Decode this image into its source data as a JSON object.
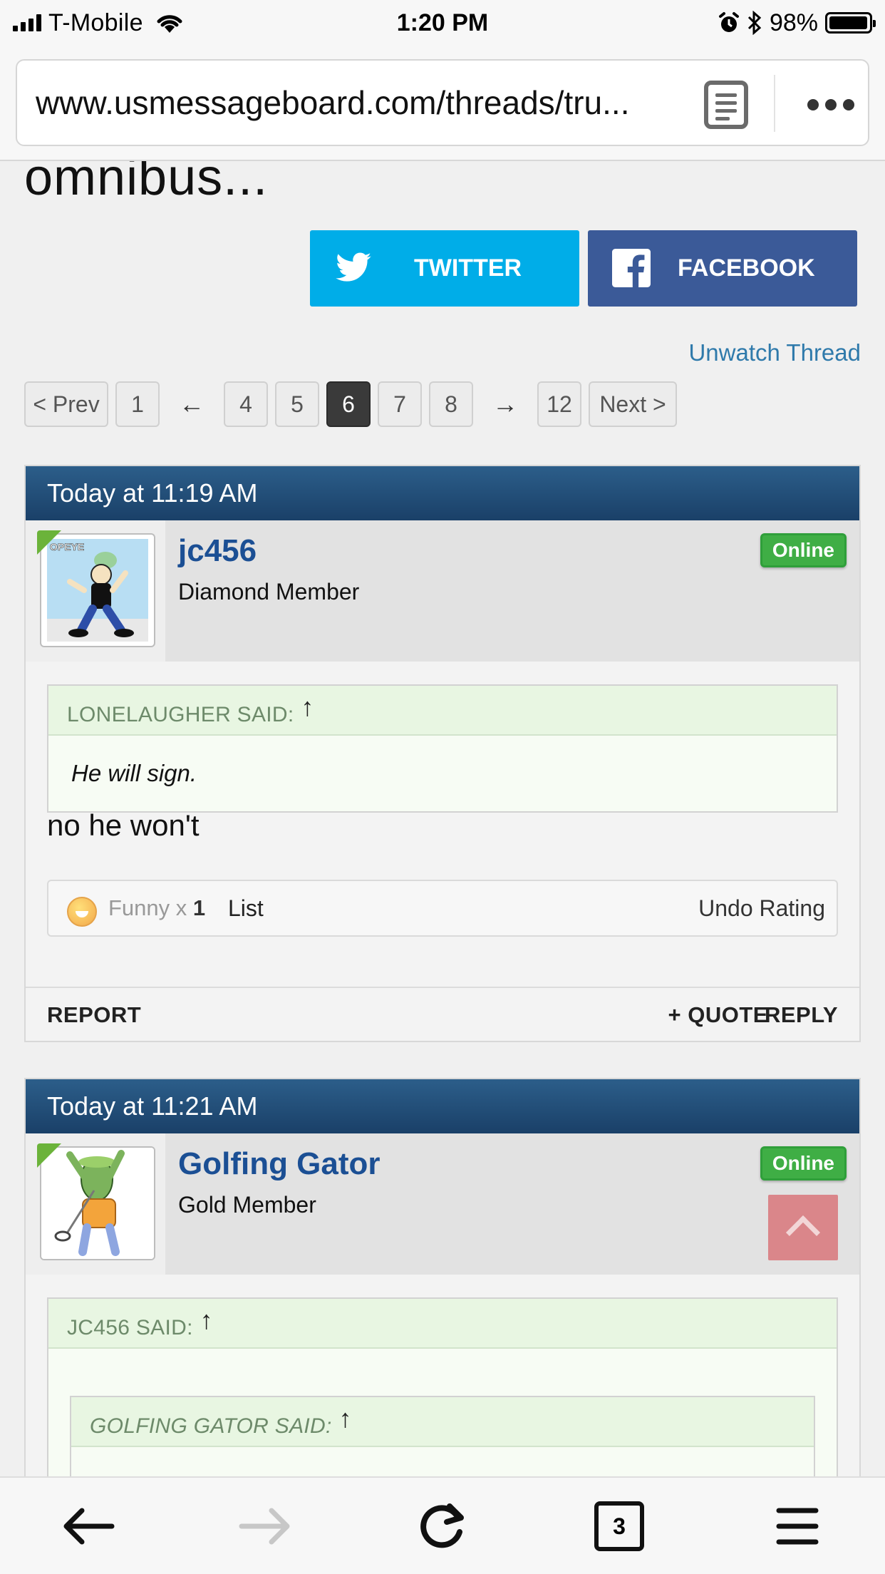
{
  "status_bar": {
    "carrier": "T-Mobile",
    "time": "1:20 PM",
    "battery_percent": "98%",
    "battery_level": 0.98,
    "icons": [
      "signal-icon",
      "wifi-icon",
      "alarm-icon",
      "bluetooth-icon",
      "battery-icon"
    ]
  },
  "browser": {
    "url": "www.usmessageboard.com/threads/tru...",
    "reader_icon": "reader-view-icon",
    "more_icon": "more-dots-icon",
    "toolbar": {
      "tab_count": "3",
      "icons": [
        "back-arrow-icon",
        "forward-arrow-icon",
        "reload-icon",
        "tabs-icon",
        "menu-icon"
      ]
    }
  },
  "thread": {
    "title_fragment": "omnibus...",
    "share": {
      "twitter_label": "TWITTER",
      "facebook_label": "FACEBOOK"
    },
    "unwatch_label": "Unwatch Thread",
    "pagination": {
      "prev": "< Prev",
      "next": "Next >",
      "pages": [
        "1",
        "←",
        "4",
        "5",
        "6",
        "7",
        "8",
        "→",
        "12"
      ],
      "current": "6"
    }
  },
  "posts": [
    {
      "timestamp": "Today at 11:19 AM",
      "username": "jc456",
      "user_title": "Diamond Member",
      "status": "Online",
      "quote": {
        "author": "LONELAUGHER SAID:",
        "arrow": "↑",
        "text": "He will sign."
      },
      "message": "no he won't",
      "rating": {
        "label": "Funny",
        "multiplier": "x",
        "count": "1",
        "list_label": "List",
        "undo_label": "Undo Rating"
      },
      "actions": {
        "report": "REPORT",
        "quote": "+ QUOTE",
        "reply": "REPLY"
      }
    },
    {
      "timestamp": "Today at 11:21 AM",
      "username": "Golfing Gator",
      "user_title": "Gold Member",
      "status": "Online",
      "quote": {
        "author": "JC456 SAID:",
        "arrow": "↑",
        "nested": {
          "author": "GOLFING GATOR SAID:",
          "arrow": "↑"
        }
      }
    }
  ],
  "colors": {
    "post_header": "#1f4a74",
    "twitter": "#00ade8",
    "facebook": "#3b5a98",
    "online_badge": "#3fae45",
    "username": "#1b4f94",
    "link": "#2f7aab"
  }
}
